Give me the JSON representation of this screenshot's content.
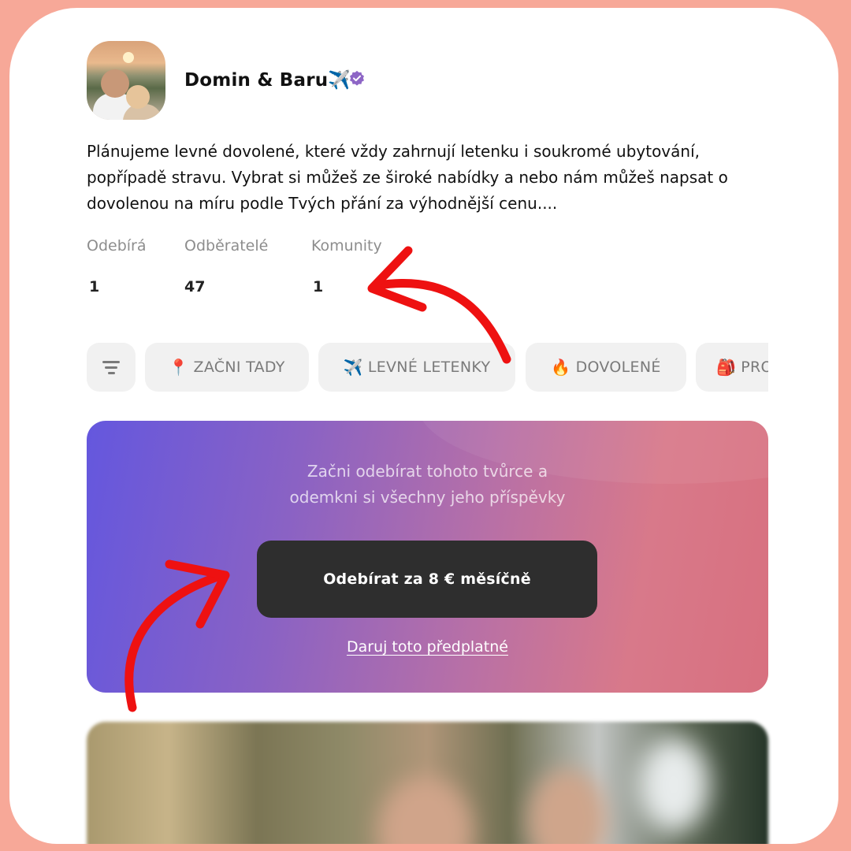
{
  "profile": {
    "name": "Domin & Baru✈️",
    "verified_icon": "verified-badge-icon",
    "bio": "Plánujeme levné dovolené, které vždy zahrnují letenku i soukromé ubytování, popřípadě stravu. Vybrat si můžeš ze široké nabídky a nebo nám můžeš napsat o dovolenou na míru podle Tvých přání za výhodnější cenu...."
  },
  "stats": [
    {
      "label": "Odebírá",
      "value": "1"
    },
    {
      "label": "Odběratelé",
      "value": "47"
    },
    {
      "label": "Komunity",
      "value": "1"
    }
  ],
  "chips": [
    {
      "icon": "filter-icon",
      "label": ""
    },
    {
      "icon": "📍",
      "label": "ZAČNI TADY"
    },
    {
      "icon": "✈️",
      "label": "LEVNÉ LETENKY"
    },
    {
      "icon": "🔥",
      "label": "DOVOLENÉ"
    },
    {
      "icon": "🎒",
      "label": "PRO"
    }
  ],
  "promo": {
    "line1": "Začni odebírat tohoto tvůrce a",
    "line2": "odemkni si všechny jeho příspěvky",
    "subscribe_label": "Odebírat za 8 € měsíčně",
    "gift_label": "Daruj toto předplatné"
  },
  "colors": {
    "frame": "#f7a898",
    "accent_arrow": "#ee1111",
    "button": "#2e2e2e",
    "gradient_start": "#6457de",
    "gradient_end": "#d8707f"
  }
}
